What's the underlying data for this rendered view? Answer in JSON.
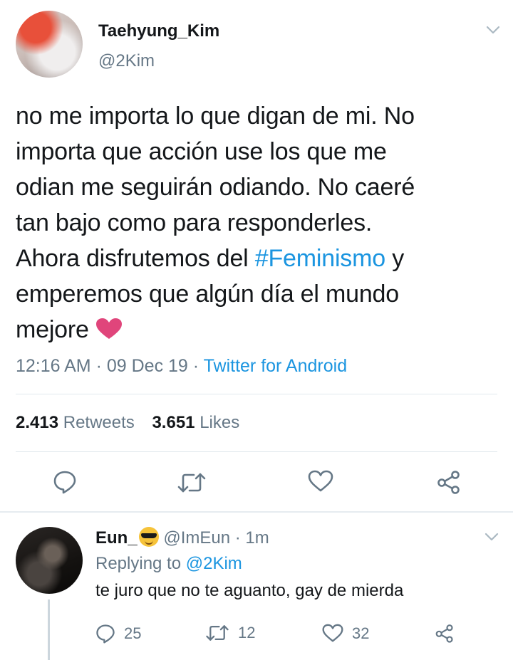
{
  "tweet": {
    "author_name": "Taehyung_Kim",
    "author_handle": "@2Kim",
    "text_parts": {
      "line1": "no me importa lo que digan de mi. No",
      "line2": "importa que acción use los que me",
      "line3": "odian me seguirán odiando. No caeré",
      "line4": "tan bajo como para responderles.",
      "line5_pre": "Ahora disfrutemos del ",
      "hashtag": "#Feminismo",
      "line5_post": " y",
      "line6": "emperemos que algún día el mundo",
      "line7": "mejore"
    },
    "time": "12:16 AM",
    "date": "09 Dec 19",
    "source": "Twitter for Android",
    "retweets_count": "2.413",
    "retweets_label": "Retweets",
    "likes_count": "3.651",
    "likes_label": "Likes",
    "actions": [
      "reply-icon",
      "retweet-icon",
      "like-icon",
      "share-icon"
    ]
  },
  "reply": {
    "author_name": "Eun_",
    "author_handle": "@ImEun",
    "time_ago": "1m",
    "replying_label": "Replying to",
    "replying_to": "@2Kim",
    "text": "te juro que no te aguanto, gay de mierda",
    "reply_count": "25",
    "retweet_count": "12",
    "like_count": "32"
  },
  "colors": {
    "link": "#1b95e0",
    "secondary": "#657786",
    "heart": "#e0457b"
  }
}
